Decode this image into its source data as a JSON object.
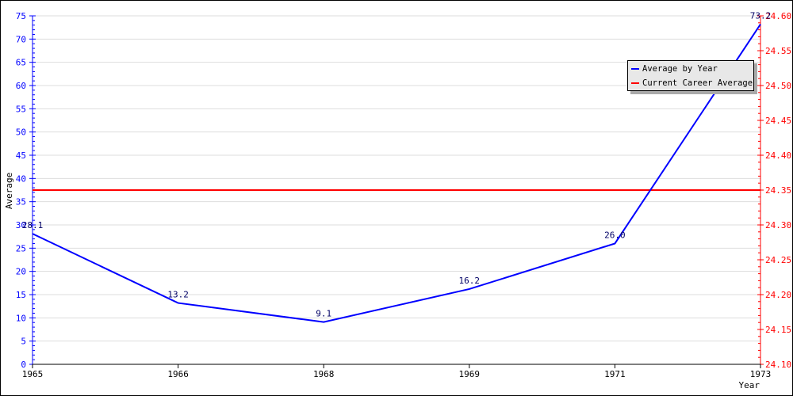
{
  "chart_data": {
    "type": "line",
    "categories": [
      "1965",
      "1966",
      "1968",
      "1969",
      "1971",
      "1973"
    ],
    "series": [
      {
        "name": "Average by Year",
        "values": [
          28.1,
          13.2,
          9.1,
          16.2,
          26.0,
          73.2
        ],
        "labels": [
          "28.1",
          "13.2",
          "9.1",
          "16.2",
          "26.0",
          "73.2"
        ],
        "color": "#0000ff",
        "axis": "left"
      },
      {
        "name": "Current Career Average",
        "value": 24.35,
        "color": "#ff0000",
        "axis": "right"
      }
    ],
    "xlabel": "Year",
    "ylabel": "Average",
    "ylim": [
      0,
      75
    ],
    "yticks": [
      0,
      5,
      10,
      15,
      20,
      25,
      30,
      35,
      40,
      45,
      50,
      55,
      60,
      65,
      70,
      75
    ],
    "y2lim": [
      24.1,
      24.6
    ],
    "y2ticks": [
      "24.10",
      "24.15",
      "24.20",
      "24.25",
      "24.30",
      "24.35",
      "24.40",
      "24.45",
      "24.50",
      "24.55",
      "24.60"
    ],
    "grid": true,
    "legend": "top-right",
    "colors": {
      "left_axis": "#0000ff",
      "right_axis": "#ff0000",
      "data_label": "#000066",
      "grid": "#dddddd"
    }
  }
}
